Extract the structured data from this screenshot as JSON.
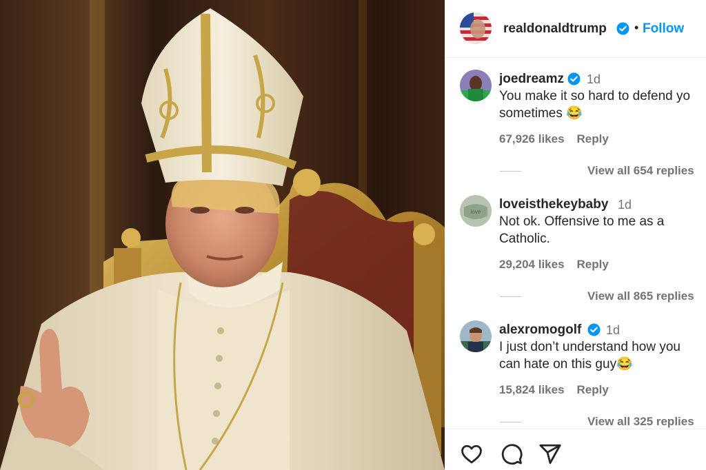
{
  "post": {
    "image_alt": "Photo of a figure in papal mitre and white vestments seated on a gilded throne"
  },
  "header": {
    "username": "realdonaldtrump",
    "separator": "•",
    "follow_label": "Follow",
    "verified_icon": "verified-badge-icon"
  },
  "comments": [
    {
      "username": "joedreamz",
      "verified": true,
      "time": "1d",
      "text_line1": "You make it so hard to defend yo",
      "text_line2": "sometimes 😂",
      "likes": "67,926 likes",
      "reply_label": "Reply",
      "view_replies": "View all 654 replies"
    },
    {
      "username": "loveisthekeybaby",
      "verified": false,
      "time": "1d",
      "text_line1": "Not ok. Offensive to me as a",
      "text_line2": "Catholic.",
      "likes": "29,204 likes",
      "reply_label": "Reply",
      "view_replies": "View all 865 replies"
    },
    {
      "username": "alexromogolf",
      "verified": true,
      "time": "1d",
      "text_line1": "I just don’t understand how you",
      "text_line2": "can hate on this guy😂",
      "likes": "15,824 likes",
      "reply_label": "Reply",
      "view_replies": "View all 325 replies"
    }
  ],
  "actions": {
    "like_icon": "heart-icon",
    "comment_icon": "comment-bubble-icon",
    "share_icon": "send-paper-plane-icon"
  },
  "colors": {
    "accent": "#0095f6",
    "text": "#262626",
    "muted": "#737373",
    "gold": "#c9a54a"
  }
}
